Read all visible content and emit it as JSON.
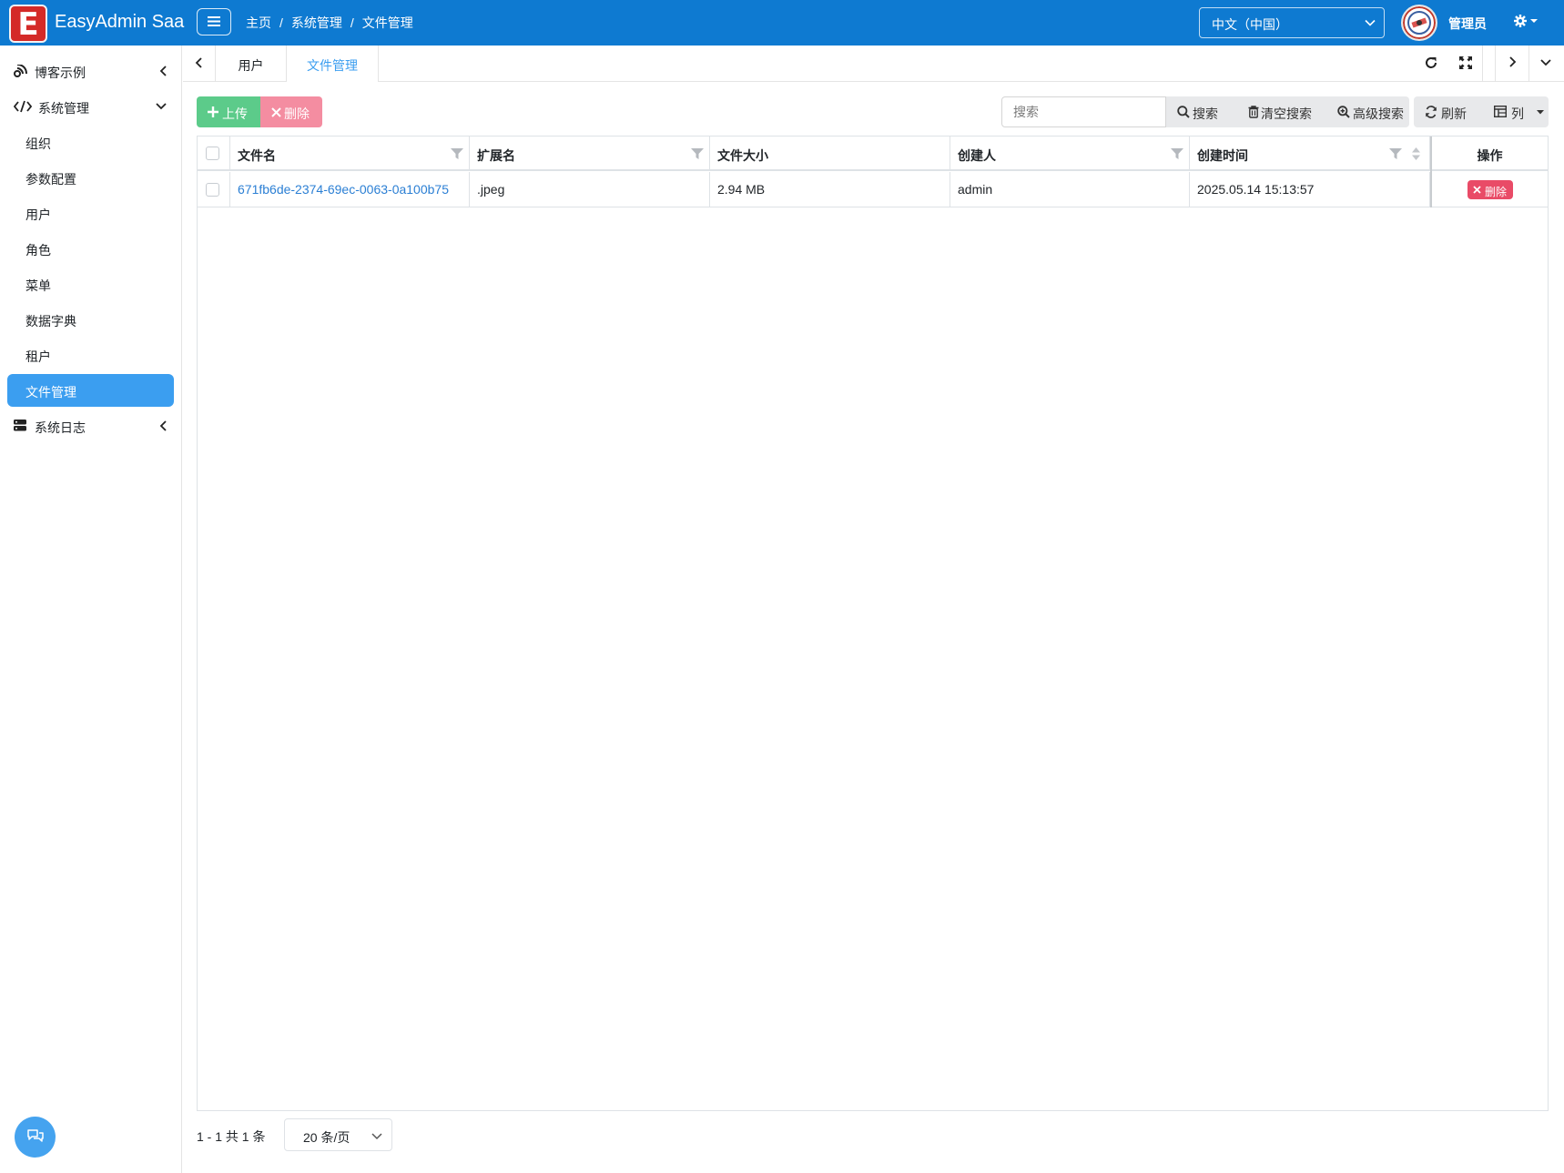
{
  "app": {
    "brand_letter": "E",
    "brand_name": "EasyAdmin Saa",
    "accent_color": "#0e7ad1",
    "active_color": "#3b9ef0"
  },
  "header": {
    "breadcrumb": [
      "主页",
      "系统管理",
      "文件管理"
    ],
    "breadcrumb_sep": "/",
    "language": "中文（中国）",
    "user_name": "管理员",
    "icons": [
      "menu-icon",
      "chevron-down-icon",
      "avatar",
      "gear-icon"
    ]
  },
  "sidebar": {
    "items": [
      {
        "label": "博客示例",
        "icon": "blog-icon",
        "caret": "chevron-left-icon"
      },
      {
        "label": "系统管理",
        "icon": "code-icon",
        "caret": "chevron-down-icon"
      },
      {
        "label": "组织"
      },
      {
        "label": "参数配置"
      },
      {
        "label": "用户"
      },
      {
        "label": "角色"
      },
      {
        "label": "菜单"
      },
      {
        "label": "数据字典"
      },
      {
        "label": "租户"
      },
      {
        "label": "文件管理",
        "active": true
      },
      {
        "label": "系统日志",
        "icon": "server-icon",
        "caret": "chevron-left-icon"
      }
    ]
  },
  "tabs": {
    "items": [
      {
        "label": "用户"
      },
      {
        "label": "文件管理",
        "active": true
      }
    ],
    "tools": [
      "refresh-icon",
      "fullscreen-icon",
      "chevron-right-icon",
      "chevron-down-icon"
    ]
  },
  "toolbar": {
    "upload_label": "上传",
    "delete_label": "删除",
    "search_placeholder": "搜索",
    "search_label": "搜索",
    "clear_search_label": "清空搜索",
    "advanced_search_label": "高级搜索",
    "refresh_label": "刷新",
    "columns_label": "列"
  },
  "table": {
    "columns": [
      "文件名",
      "扩展名",
      "文件大小",
      "创建人",
      "创建时间",
      "操作"
    ],
    "rows": [
      {
        "file_name": "671fb6de-2374-69ec-0063-0a100b75",
        "extension": ".jpeg",
        "size": "2.94 MB",
        "creator": "admin",
        "created_at": "2025.05.14 15:13:57",
        "action_label": "删除"
      }
    ]
  },
  "pagination": {
    "summary": "1 - 1 共 1 条",
    "page_size": "20 条/页"
  }
}
